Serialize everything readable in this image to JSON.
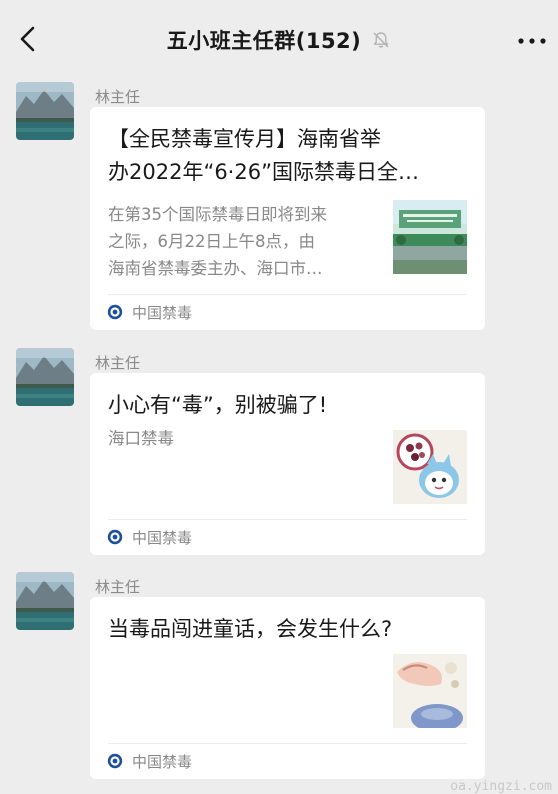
{
  "header": {
    "title": "五小班主任群(152)",
    "back_icon": "chevron-left-icon",
    "mute_icon": "bell-muted-icon",
    "more_icon": "more-dots-icon"
  },
  "messages": [
    {
      "sender": "林主任",
      "card": {
        "title": "【全民禁毒宣传月】海南省举办2022年“6·26”国际禁毒日全…",
        "title_line1": "【全民禁毒宣传月】海南省举",
        "title_line2": "办2022年“6·26”国际禁毒日全…",
        "description_line1": "在第35个国际禁毒日即将到来",
        "description_line2": "之际，6月22日上午8点，由",
        "description_line3": "海南省禁毒委主办、海口市…",
        "source": "中国禁毒"
      }
    },
    {
      "sender": "林主任",
      "card": {
        "title": "小心有“毒”，别被骗了!",
        "description_line1": "海口禁毒",
        "source": "中国禁毒"
      }
    },
    {
      "sender": "林主任",
      "card": {
        "title": "当毒品闯进童话，会发生什么?",
        "source": "中国禁毒"
      }
    }
  ],
  "watermark": "oa.yingzi.com",
  "colors": {
    "background": "#ededed",
    "card": "#ffffff",
    "secondary_text": "#888888"
  }
}
